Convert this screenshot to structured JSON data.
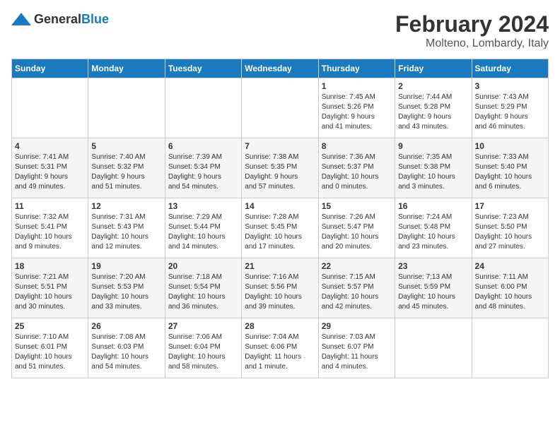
{
  "header": {
    "logo_general": "General",
    "logo_blue": "Blue",
    "month": "February 2024",
    "location": "Molteno, Lombardy, Italy"
  },
  "days_of_week": [
    "Sunday",
    "Monday",
    "Tuesday",
    "Wednesday",
    "Thursday",
    "Friday",
    "Saturday"
  ],
  "weeks": [
    [
      {
        "day": "",
        "detail": ""
      },
      {
        "day": "",
        "detail": ""
      },
      {
        "day": "",
        "detail": ""
      },
      {
        "day": "",
        "detail": ""
      },
      {
        "day": "1",
        "detail": "Sunrise: 7:45 AM\nSunset: 5:26 PM\nDaylight: 9 hours\nand 41 minutes."
      },
      {
        "day": "2",
        "detail": "Sunrise: 7:44 AM\nSunset: 5:28 PM\nDaylight: 9 hours\nand 43 minutes."
      },
      {
        "day": "3",
        "detail": "Sunrise: 7:43 AM\nSunset: 5:29 PM\nDaylight: 9 hours\nand 46 minutes."
      }
    ],
    [
      {
        "day": "4",
        "detail": "Sunrise: 7:41 AM\nSunset: 5:31 PM\nDaylight: 9 hours\nand 49 minutes."
      },
      {
        "day": "5",
        "detail": "Sunrise: 7:40 AM\nSunset: 5:32 PM\nDaylight: 9 hours\nand 51 minutes."
      },
      {
        "day": "6",
        "detail": "Sunrise: 7:39 AM\nSunset: 5:34 PM\nDaylight: 9 hours\nand 54 minutes."
      },
      {
        "day": "7",
        "detail": "Sunrise: 7:38 AM\nSunset: 5:35 PM\nDaylight: 9 hours\nand 57 minutes."
      },
      {
        "day": "8",
        "detail": "Sunrise: 7:36 AM\nSunset: 5:37 PM\nDaylight: 10 hours\nand 0 minutes."
      },
      {
        "day": "9",
        "detail": "Sunrise: 7:35 AM\nSunset: 5:38 PM\nDaylight: 10 hours\nand 3 minutes."
      },
      {
        "day": "10",
        "detail": "Sunrise: 7:33 AM\nSunset: 5:40 PM\nDaylight: 10 hours\nand 6 minutes."
      }
    ],
    [
      {
        "day": "11",
        "detail": "Sunrise: 7:32 AM\nSunset: 5:41 PM\nDaylight: 10 hours\nand 9 minutes."
      },
      {
        "day": "12",
        "detail": "Sunrise: 7:31 AM\nSunset: 5:43 PM\nDaylight: 10 hours\nand 12 minutes."
      },
      {
        "day": "13",
        "detail": "Sunrise: 7:29 AM\nSunset: 5:44 PM\nDaylight: 10 hours\nand 14 minutes."
      },
      {
        "day": "14",
        "detail": "Sunrise: 7:28 AM\nSunset: 5:45 PM\nDaylight: 10 hours\nand 17 minutes."
      },
      {
        "day": "15",
        "detail": "Sunrise: 7:26 AM\nSunset: 5:47 PM\nDaylight: 10 hours\nand 20 minutes."
      },
      {
        "day": "16",
        "detail": "Sunrise: 7:24 AM\nSunset: 5:48 PM\nDaylight: 10 hours\nand 23 minutes."
      },
      {
        "day": "17",
        "detail": "Sunrise: 7:23 AM\nSunset: 5:50 PM\nDaylight: 10 hours\nand 27 minutes."
      }
    ],
    [
      {
        "day": "18",
        "detail": "Sunrise: 7:21 AM\nSunset: 5:51 PM\nDaylight: 10 hours\nand 30 minutes."
      },
      {
        "day": "19",
        "detail": "Sunrise: 7:20 AM\nSunset: 5:53 PM\nDaylight: 10 hours\nand 33 minutes."
      },
      {
        "day": "20",
        "detail": "Sunrise: 7:18 AM\nSunset: 5:54 PM\nDaylight: 10 hours\nand 36 minutes."
      },
      {
        "day": "21",
        "detail": "Sunrise: 7:16 AM\nSunset: 5:56 PM\nDaylight: 10 hours\nand 39 minutes."
      },
      {
        "day": "22",
        "detail": "Sunrise: 7:15 AM\nSunset: 5:57 PM\nDaylight: 10 hours\nand 42 minutes."
      },
      {
        "day": "23",
        "detail": "Sunrise: 7:13 AM\nSunset: 5:59 PM\nDaylight: 10 hours\nand 45 minutes."
      },
      {
        "day": "24",
        "detail": "Sunrise: 7:11 AM\nSunset: 6:00 PM\nDaylight: 10 hours\nand 48 minutes."
      }
    ],
    [
      {
        "day": "25",
        "detail": "Sunrise: 7:10 AM\nSunset: 6:01 PM\nDaylight: 10 hours\nand 51 minutes."
      },
      {
        "day": "26",
        "detail": "Sunrise: 7:08 AM\nSunset: 6:03 PM\nDaylight: 10 hours\nand 54 minutes."
      },
      {
        "day": "27",
        "detail": "Sunrise: 7:06 AM\nSunset: 6:04 PM\nDaylight: 10 hours\nand 58 minutes."
      },
      {
        "day": "28",
        "detail": "Sunrise: 7:04 AM\nSunset: 6:06 PM\nDaylight: 11 hours\nand 1 minute."
      },
      {
        "day": "29",
        "detail": "Sunrise: 7:03 AM\nSunset: 6:07 PM\nDaylight: 11 hours\nand 4 minutes."
      },
      {
        "day": "",
        "detail": ""
      },
      {
        "day": "",
        "detail": ""
      }
    ]
  ]
}
